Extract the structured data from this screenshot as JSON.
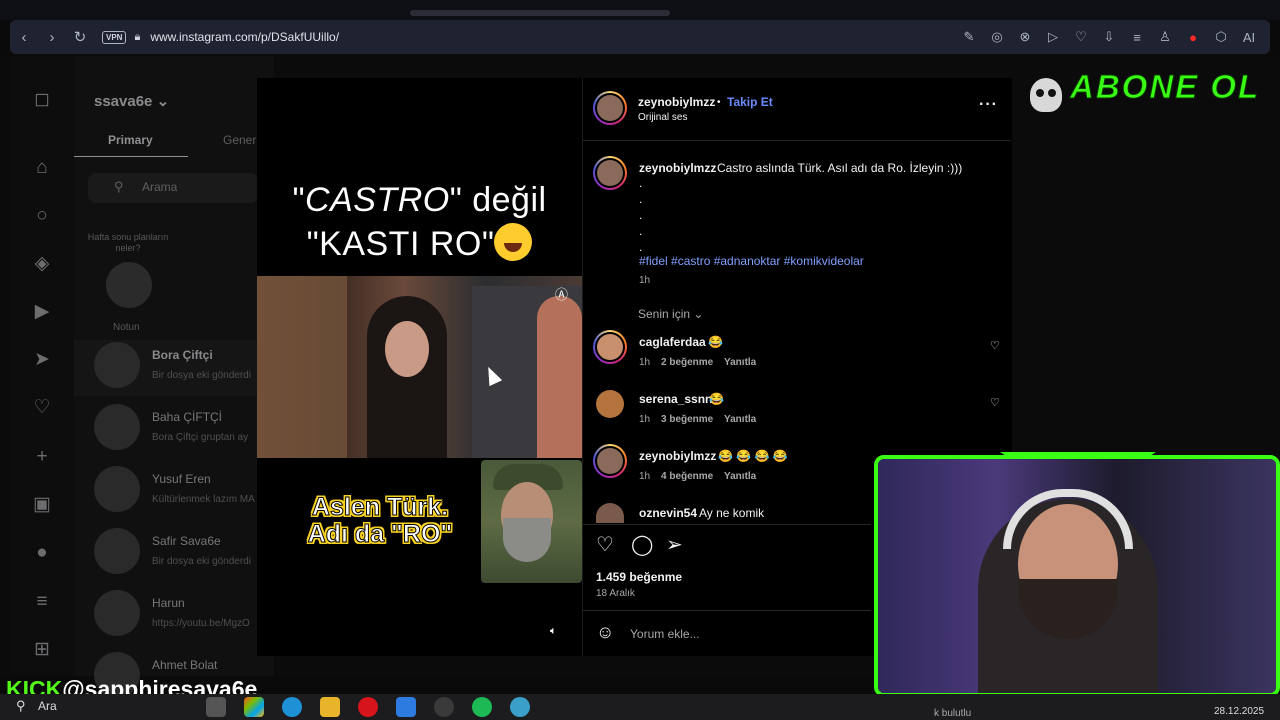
{
  "browser": {
    "vpn_label": "VPN",
    "url": "www.instagram.com/p/DSakfUUillo/",
    "ai_label": "AI"
  },
  "dm": {
    "username": "ssava6e",
    "tab_primary": "Primary",
    "tab_general": "Gener",
    "search_placeholder": "Arama",
    "note_text": "Hafta sonu planların neler?",
    "note_label": "Notun",
    "conversations": [
      {
        "name": "Bora Çiftçi",
        "sub": "Bir dosya eki gönderdi"
      },
      {
        "name": "Baha ÇİFTÇİ",
        "sub": "Bora Çiftçi gruptan ay"
      },
      {
        "name": "Yusuf Eren",
        "sub": "Kültürlenmek lazım MA"
      },
      {
        "name": "Safir Sava6e",
        "sub": "Bir dosya eki gönderdi"
      },
      {
        "name": "Harun",
        "sub": "https://youtu.be/MgzO"
      },
      {
        "name": "Ahmet Bolat",
        "sub": ""
      }
    ]
  },
  "reel": {
    "caption_q1": "\"",
    "caption_castro": "CASTRO",
    "caption_rest1": "\" değil",
    "caption_line2": "\"KASTI RO\"",
    "overlay_line1": "Aslen Türk.",
    "overlay_line2": "Adı da \"RO\""
  },
  "post": {
    "author": "zeynobiylmzz",
    "follow": "Takip Et",
    "audio": "Orijinal ses",
    "caption": "Castro aslında Türk. Asıl adı da Ro. İzleyin :)))",
    "caption_dots": ".",
    "hashtags": "#fidel #castro #adnanoktar #komikvideolar",
    "caption_time": "1h",
    "sort_label": "Senin için",
    "comments": [
      {
        "user": "caglaferdaa",
        "text": "😂",
        "time": "1h",
        "likes": "2 beğenme",
        "reply": "Yanıtla"
      },
      {
        "user": "serena_ssnn",
        "text": "😂",
        "time": "1h",
        "likes": "3 beğenme",
        "reply": "Yanıtla"
      },
      {
        "user": "zeynobiylmzz",
        "text": "😂 😂 😂 😂",
        "time": "1h",
        "likes": "4 beğenme",
        "reply": "Yanıtla"
      },
      {
        "user": "oznevin54",
        "text": "Ay ne komik",
        "time": "",
        "likes": "",
        "reply": ""
      }
    ],
    "likes_total": "1.459 beğenme",
    "date": "18 Aralık",
    "comment_placeholder": "Yorum ekle..."
  },
  "overlay": {
    "abone": "ABONE OL",
    "kick_k": "KICK",
    "kick_handle": "@sapphiresava6e"
  },
  "taskbar": {
    "search": "Ara",
    "status": "k bulutlu",
    "date": "28.12.2025"
  },
  "colors": {
    "accent_link": "#6b8cff",
    "overlay_green": "#39ff14",
    "kick_green": "#53fc18"
  }
}
